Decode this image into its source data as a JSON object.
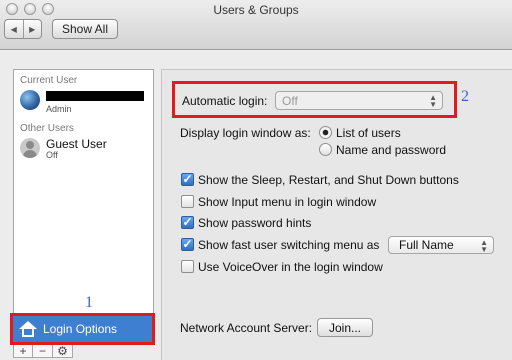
{
  "window": {
    "title": "Users & Groups"
  },
  "toolbar": {
    "back_glyph": "◀",
    "forward_glyph": "▶",
    "show_all_label": "Show All"
  },
  "sidebar": {
    "current_user_label": "Current User",
    "current_user": {
      "role": "Admin",
      "avatar": "earth-icon"
    },
    "other_users_label": "Other Users",
    "guest_user": {
      "name": "Guest User",
      "status": "Off"
    },
    "login_options_label": "Login Options",
    "footer": {
      "add_label": "+",
      "remove_label": "−",
      "gear_label": "⚙"
    }
  },
  "login": {
    "automatic_login_label": "Automatic login:",
    "automatic_login_value": "Off",
    "display_as_label": "Display login window as:",
    "display_options": [
      {
        "label": "List of users",
        "selected": true
      },
      {
        "label": "Name and password",
        "selected": false
      }
    ],
    "checkboxes": [
      {
        "label": "Show the Sleep, Restart, and Shut Down buttons",
        "checked": true
      },
      {
        "label": "Show Input menu in login window",
        "checked": false
      },
      {
        "label": "Show password hints",
        "checked": true
      },
      {
        "label": "Show fast user switching menu as",
        "checked": true
      },
      {
        "label": "Use VoiceOver in the login window",
        "checked": false
      }
    ],
    "fast_switch_value": "Full Name",
    "network_server_label": "Network Account Server:",
    "join_label": "Join..."
  },
  "annotations": {
    "marker_1": "1",
    "marker_2": "2",
    "box_color": "#e31a1a",
    "marker_color": "#3b63d6"
  },
  "colors": {
    "selection": "#3f7fd1"
  }
}
